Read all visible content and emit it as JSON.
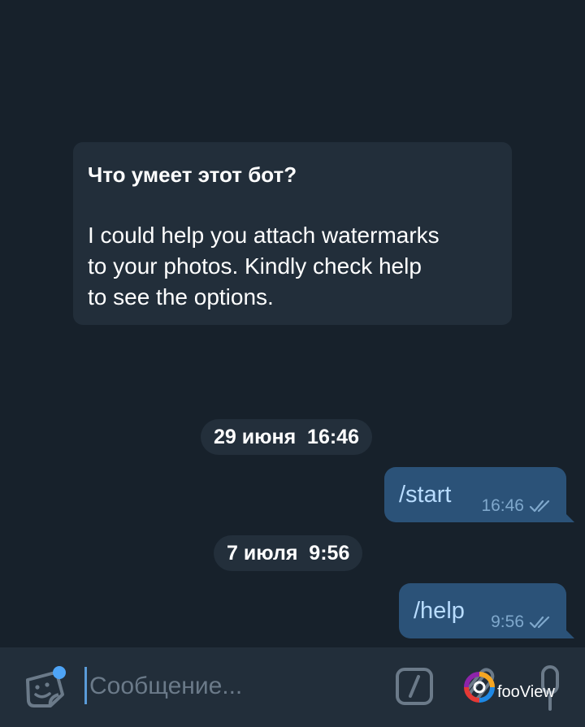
{
  "bot_info": {
    "title": "Что умеет этот бот?",
    "description_lines": [
      "I could help you attach watermarks",
      "to your photos. Kindly check help",
      "to see the options."
    ]
  },
  "messages": [
    {
      "date_label": "29 июня  16:46",
      "text": "/start",
      "time": "16:46",
      "status_icon": "double-check-icon"
    },
    {
      "date_label": "7 июля  9:56",
      "text": "/help",
      "time": "9:56",
      "status_icon": "double-check-icon"
    }
  ],
  "composer": {
    "placeholder": "Сообщение...",
    "value": "",
    "icons": [
      "sticker-icon",
      "bot-command-icon",
      "paperclip-icon",
      "microphone-icon"
    ]
  },
  "watermark": {
    "text": "fooView"
  },
  "colors": {
    "background": "#17212b",
    "bubble_in": "#222e3a",
    "bubble_out": "#2b5278",
    "out_text": "#b8dcff",
    "accent": "#4ea4f6"
  }
}
